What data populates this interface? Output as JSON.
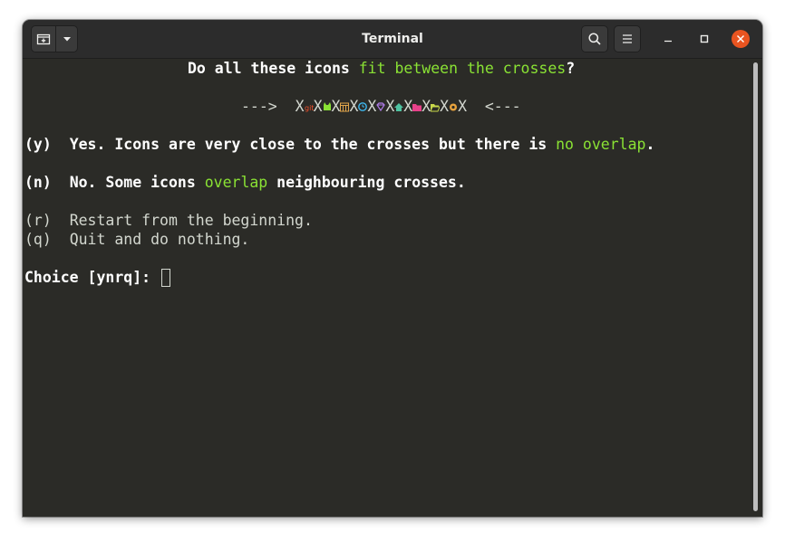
{
  "window": {
    "title": "Terminal"
  },
  "icons": {
    "new_tab": "new-tab-icon",
    "tab_menu": "chevron-down-icon",
    "search": "search-icon",
    "menu": "hamburger-menu-icon",
    "minimize": "minimize-icon",
    "maximize": "maximize-icon",
    "close": "close-icon"
  },
  "colors": {
    "accent_green": "#8ae234",
    "close_orange": "#e95420",
    "terminal_bg": "#2b2b27"
  },
  "terminal": {
    "question": {
      "p1": "Do all these icons ",
      "p2": "fit between the crosses",
      "p3": "?"
    },
    "arrow_left": "--->",
    "arrow_right": "<---",
    "cross": "X",
    "option_y": {
      "key": "(y)",
      "p1": "Yes. Icons are very close to the crosses but there is ",
      "p2": "no overlap",
      "p3": "."
    },
    "option_n": {
      "key": "(n)",
      "p1": "No. Some icons ",
      "p2": "overlap",
      "p3": " neighbouring crosses."
    },
    "option_r": {
      "key": "(r)",
      "text": "Restart from the beginning."
    },
    "option_q": {
      "key": "(q)",
      "text": "Quit and do nothing."
    },
    "prompt": "Choice [ynrq]:"
  }
}
